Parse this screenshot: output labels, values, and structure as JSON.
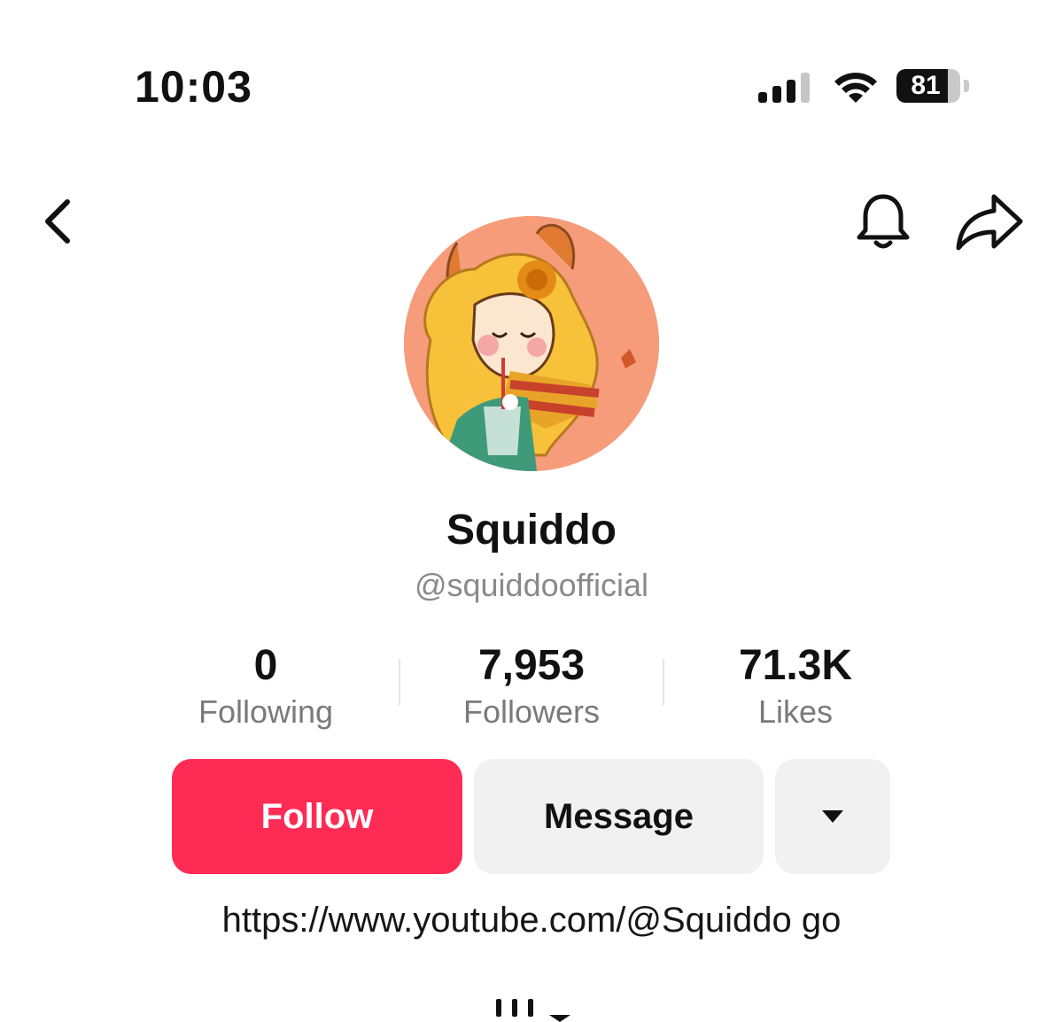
{
  "status_bar": {
    "time": "10:03",
    "battery_level": "81",
    "battery_fraction": 0.81,
    "icons": [
      "signal-icon",
      "wifi-icon",
      "battery-icon"
    ]
  },
  "nav": {
    "icons": [
      "chevron-left-icon",
      "bell-icon",
      "share-icon"
    ]
  },
  "profile": {
    "display_name": "Squiddo",
    "username": "@squiddoofficial",
    "avatar": "profile-avatar-illustration"
  },
  "stats": [
    {
      "value": "0",
      "label": "Following"
    },
    {
      "value": "7,953",
      "label": "Followers"
    },
    {
      "value": "71.3K",
      "label": "Likes"
    }
  ],
  "actions": {
    "follow_label": "Follow",
    "message_label": "Message",
    "more_icon": "caret-down-icon"
  },
  "bio": {
    "link_text": "https://www.youtube.com/@Squiddo go"
  },
  "colors": {
    "follow_button": "#fe2c55",
    "secondary_button": "#f1f1f2",
    "muted_text": "#8a8a8a"
  }
}
